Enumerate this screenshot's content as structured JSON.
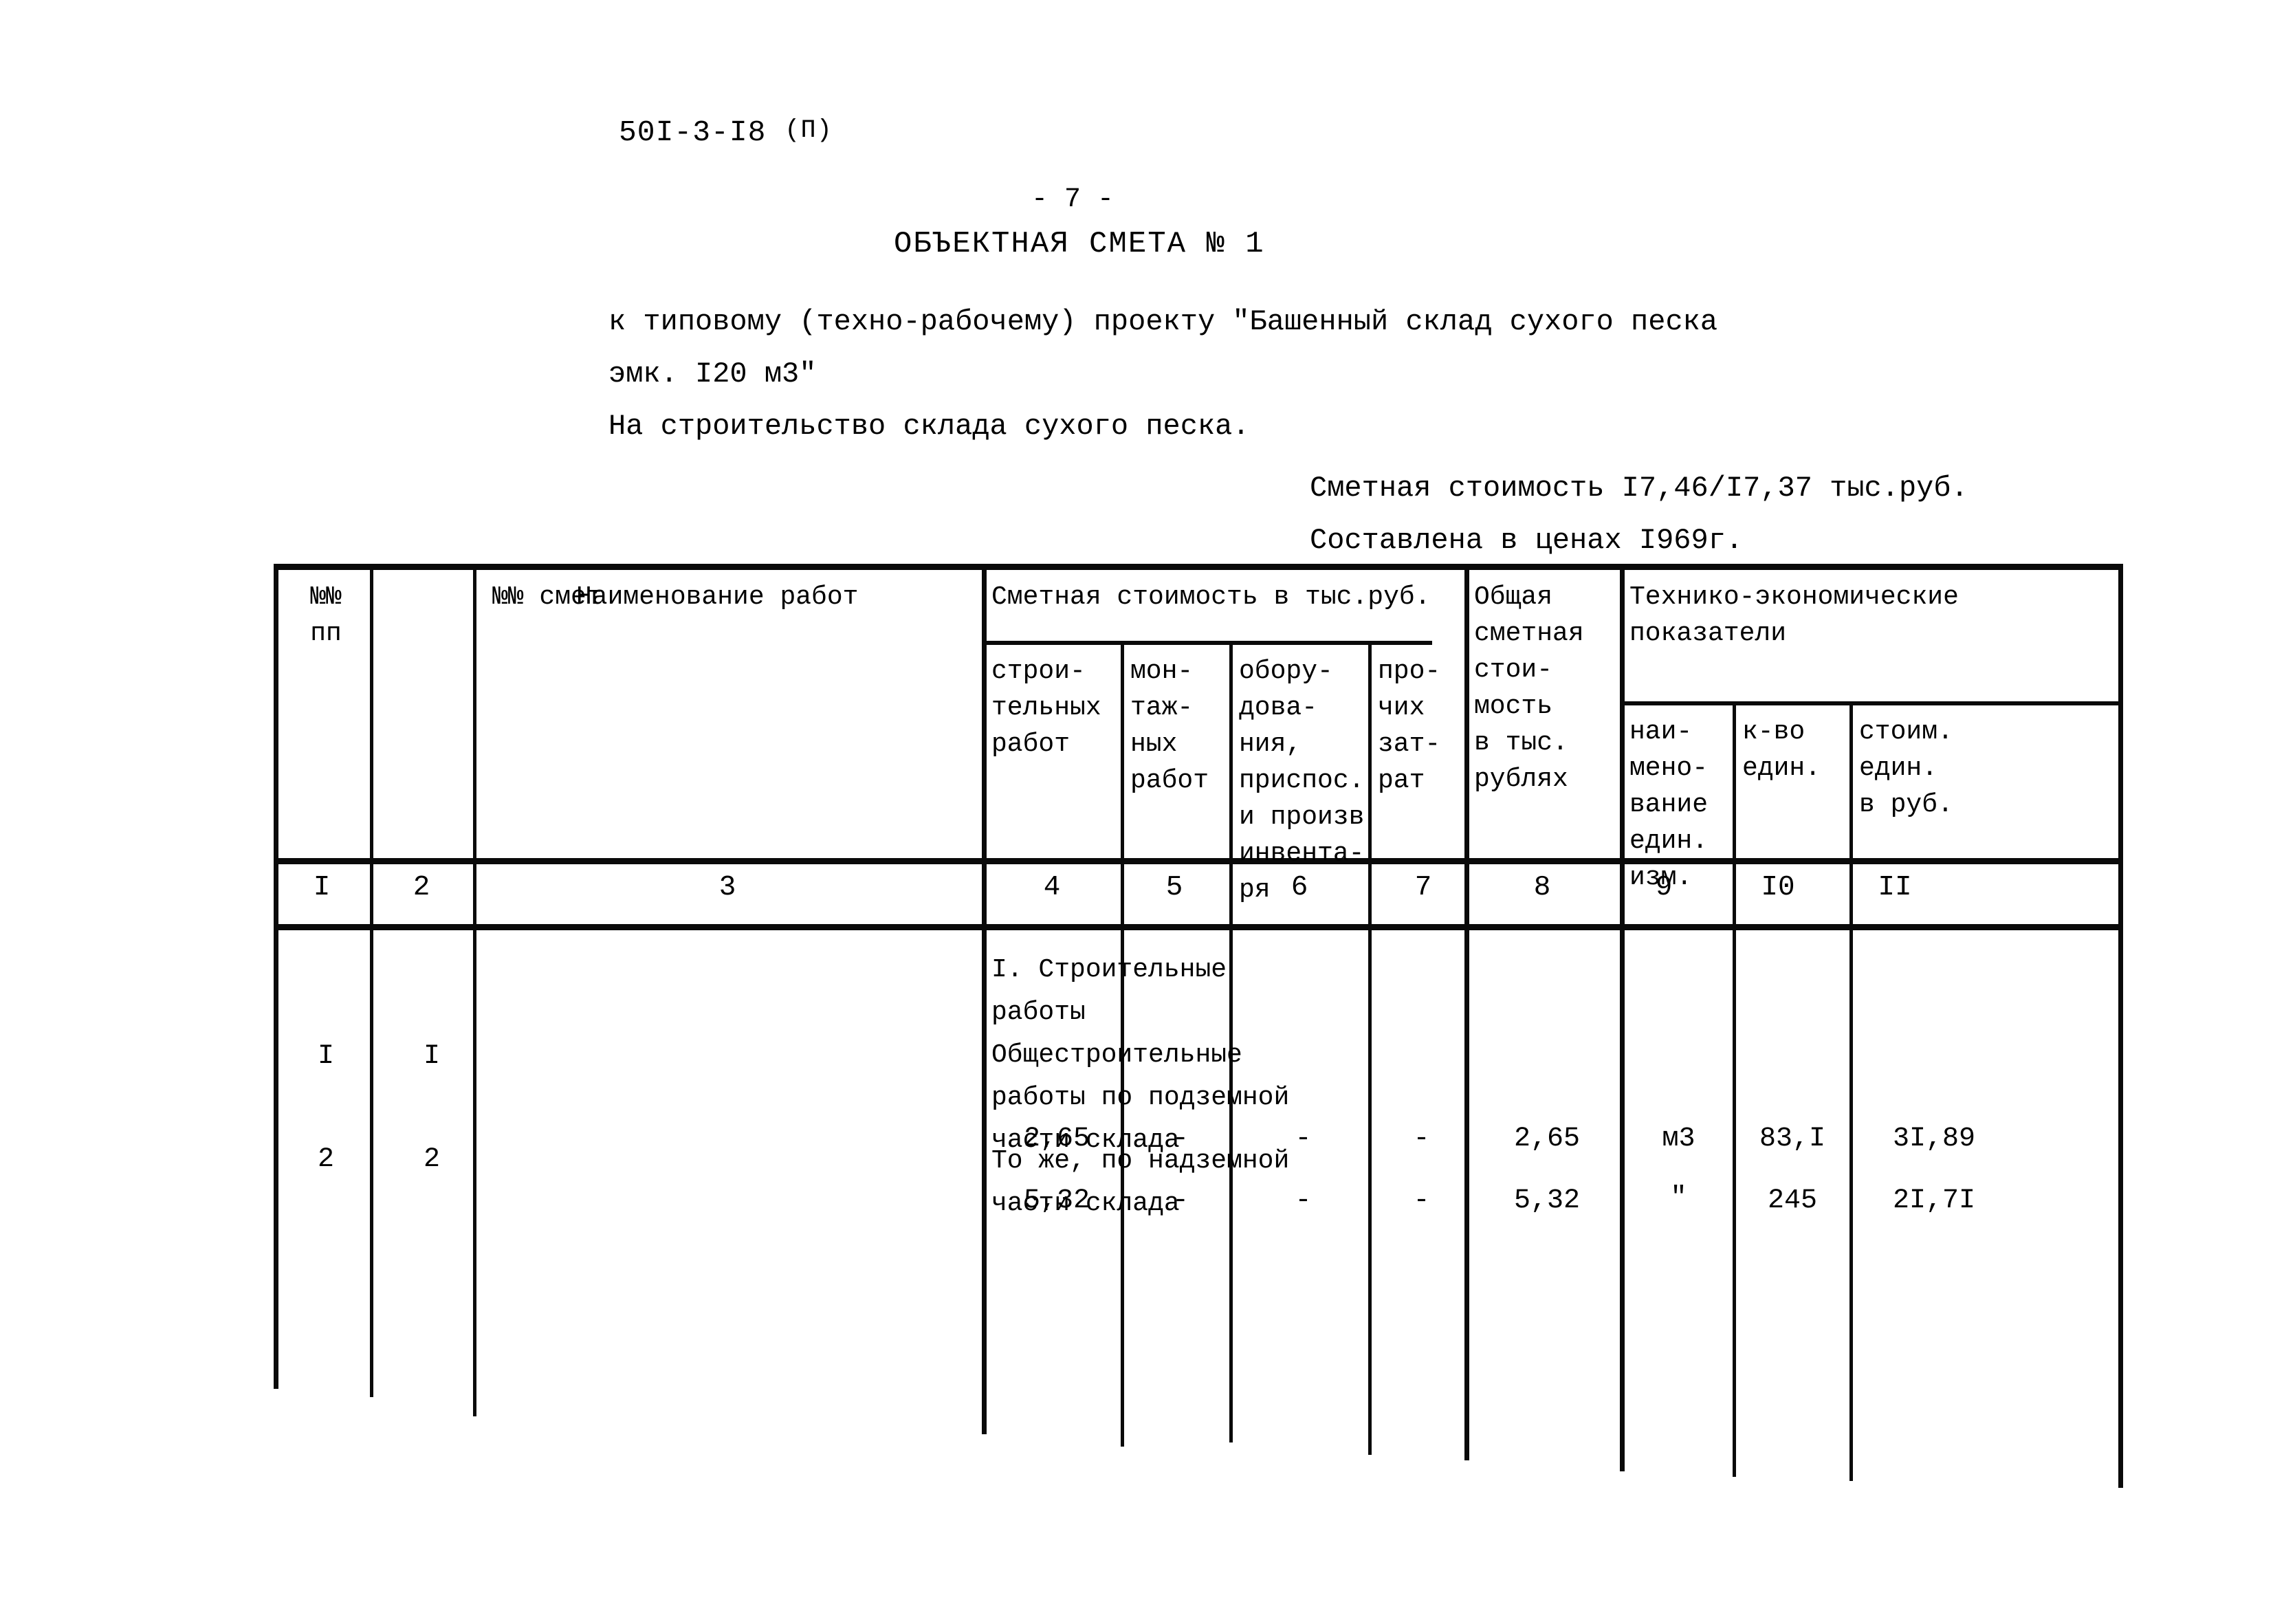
{
  "document": {
    "code": "50I-3-I8",
    "code_suffix": "(П)",
    "page_marker": "- 7 -",
    "title": "ОБЪЕКТНАЯ СМЕТА № 1",
    "intro_lines": [
      "к типовому (техно-рабочему) проекту \"Башенный склад сухого песка",
      "эмк. I20 м3\"",
      "На строительство склада сухого песка."
    ],
    "cost_summary": "Сметная стоимость I7,46/I7,37 тыс.руб.",
    "price_basis": "Составлена в ценах I969г."
  },
  "table": {
    "headers": {
      "pp": "№№\nпп",
      "smet": "№№ смет",
      "work_name": "Наименование работ",
      "estimate_group": "Сметная стоимость в тыс.руб.",
      "construction": "строи-\nтельных\nработ",
      "assembly": "мон-\nтаж-\nных\nработ",
      "equipment": "обору-\nдова-\nния,\nприспос.\nи произв\nинвента-\nря",
      "other": "про-\nчих\nзат-\nрат",
      "total": "Общая\nсметная\nстои-\nмость\nв тыс.\nрублях",
      "tech_group": "Технико-экономические\nпоказатели",
      "unit_name": "наи-\nмено-\nвание\nедин.\nизм.",
      "unit_qty": "к-во\nедин.",
      "unit_cost": "стоим.\nедин.\nв руб."
    },
    "column_numbers": [
      "I",
      "2",
      "3",
      "4",
      "5",
      "6",
      "7",
      "8",
      "9",
      "I0",
      "II"
    ],
    "section_title": "I. Строительные\nработы",
    "rows": [
      {
        "pp": "I",
        "smet": "I",
        "work_name": "Общестроительные\nработы по подземной\nчасти склада",
        "construction": "2,65",
        "assembly": "-",
        "equipment": "-",
        "other": "-",
        "total": "2,65",
        "unit_name": "м3",
        "unit_qty": "83,I",
        "unit_cost": "3I,89"
      },
      {
        "pp": "2",
        "smet": "2",
        "work_name": "То же, по надземной\nчасти склада",
        "construction": "5,32",
        "assembly": "-",
        "equipment": "-",
        "other": "-",
        "total": "5,32",
        "unit_name": "\"",
        "unit_qty": "245",
        "unit_cost": "2I,7I"
      }
    ]
  }
}
